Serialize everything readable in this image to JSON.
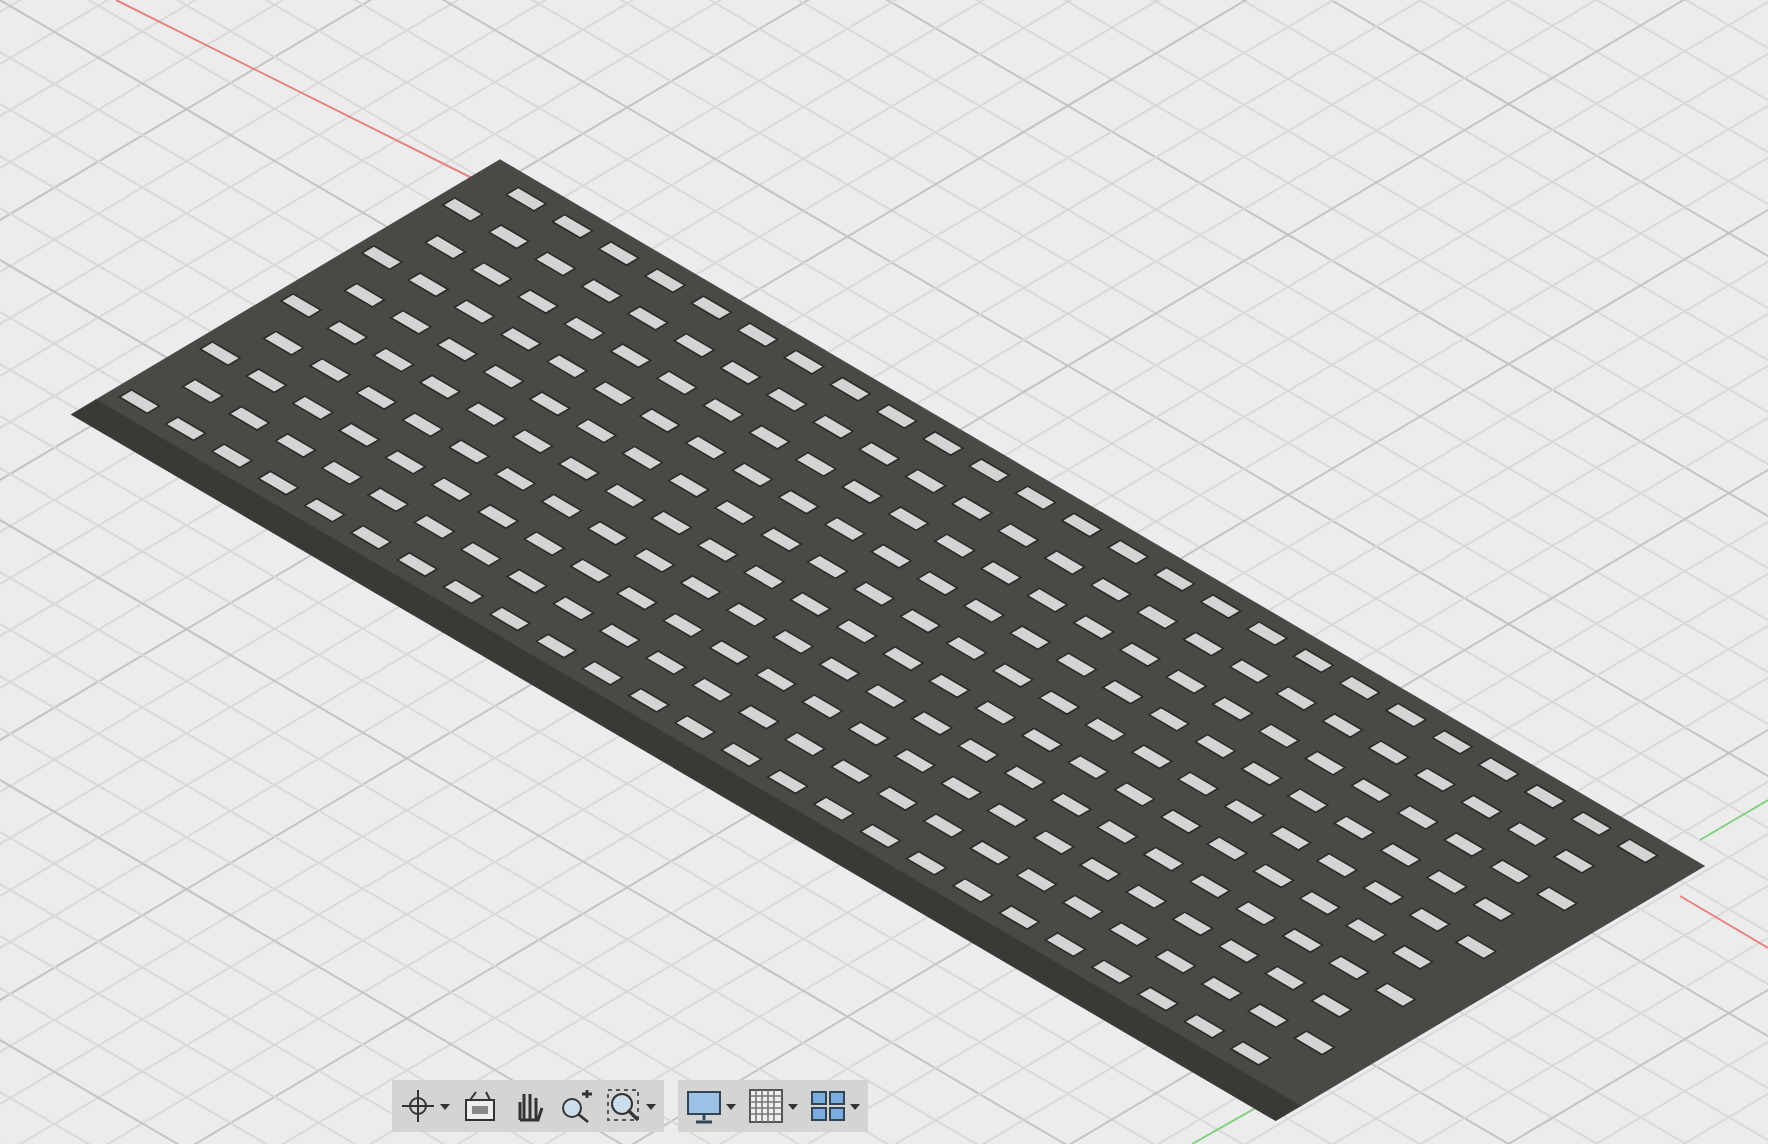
{
  "toolbar": {
    "groups": [
      {
        "items": [
          {
            "kind": "orbit",
            "dropdown": true
          },
          {
            "kind": "look-at",
            "dropdown": false
          },
          {
            "kind": "pan",
            "dropdown": false
          },
          {
            "kind": "zoom",
            "dropdown": false
          },
          {
            "kind": "fit",
            "dropdown": true
          }
        ]
      },
      {
        "items": [
          {
            "kind": "display",
            "dropdown": true
          },
          {
            "kind": "grid",
            "dropdown": true
          },
          {
            "kind": "viewports",
            "dropdown": true
          }
        ]
      }
    ]
  }
}
